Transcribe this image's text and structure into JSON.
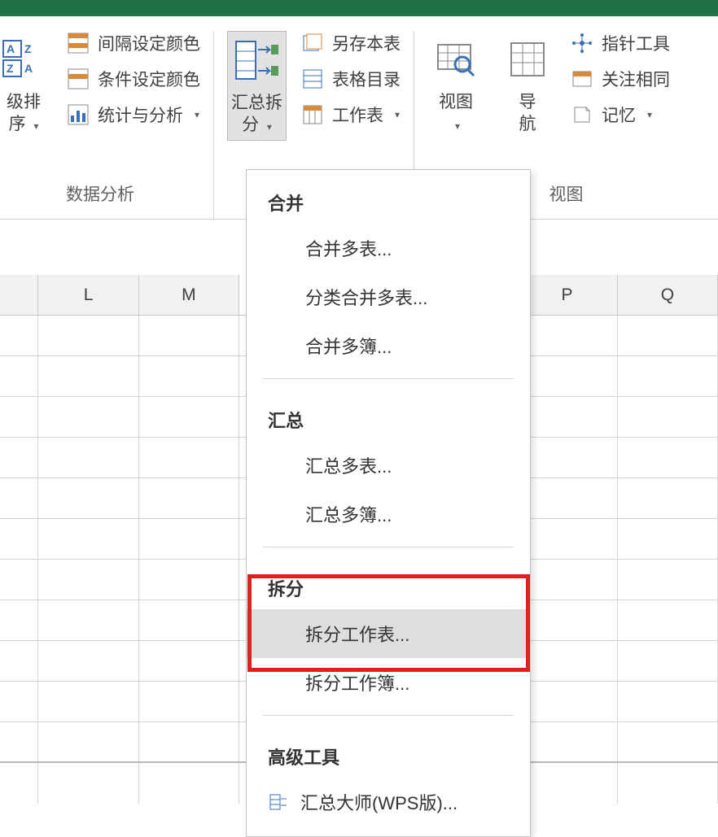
{
  "ribbon": {
    "group_data_analysis_label": "数据分析",
    "group_view_label": "视图",
    "sort_button": "级排\n序",
    "interval_color": "间隔设定颜色",
    "condition_color": "条件设定颜色",
    "stats_analysis": "统计与分析",
    "summary_split": "汇总拆\n分",
    "save_as_sheet": "另存本表",
    "table_contents": "表格目录",
    "worksheet": "工作表",
    "view_button": "视图",
    "nav_button": "导\n航",
    "pointer_tool": "指针工具",
    "focus_related": "关注相同",
    "memory": "记忆"
  },
  "columns": [
    "L",
    "M",
    "P",
    "Q"
  ],
  "menu": {
    "section_merge": "合并",
    "merge_multi_sheets": "合并多表...",
    "category_merge": "分类合并多表...",
    "merge_multi_books": "合并多簿...",
    "section_summary": "汇总",
    "summary_multi_sheets": "汇总多表...",
    "summary_multi_books": "汇总多簿...",
    "section_split": "拆分",
    "split_worksheet": "拆分工作表...",
    "split_workbook": "拆分工作簿...",
    "section_advanced": "高级工具",
    "summary_master": "汇总大师(WPS版)..."
  }
}
